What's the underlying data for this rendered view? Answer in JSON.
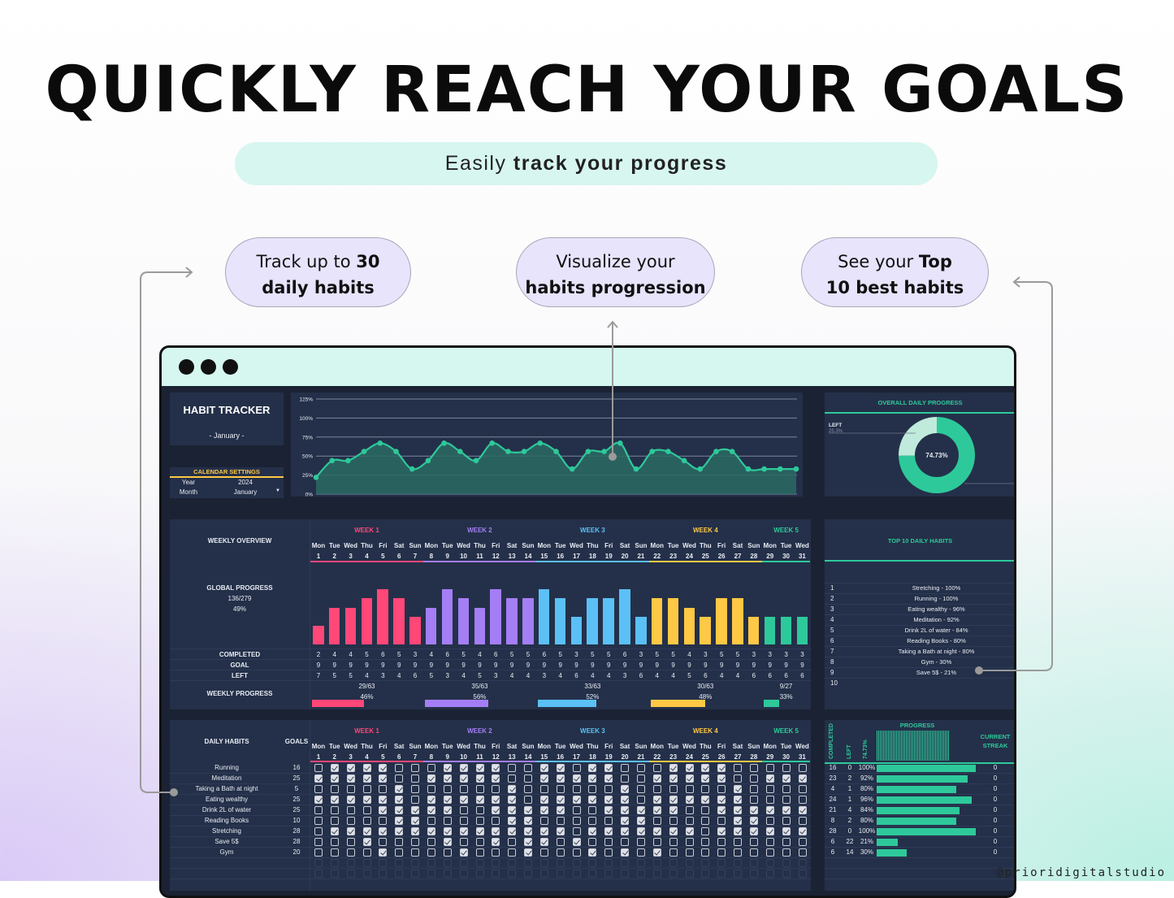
{
  "headline": "QUICKLY REACH YOUR GOALS",
  "subtitle": {
    "pre": "Easily ",
    "bold": "track your progress"
  },
  "callouts": [
    {
      "line1_pre": "Track up to ",
      "line1_bold": "30",
      "line2_bold": "daily habits"
    },
    {
      "line1_pre": "Visualize your",
      "line1_bold": "",
      "line2_bold": "habits progression"
    },
    {
      "line1_pre": "See your ",
      "line1_bold": "Top",
      "line2_bold": "10 best habits"
    }
  ],
  "watermark": "@prioridigitalstudio",
  "colors": {
    "accent": "#2ec99a",
    "panel": "#243049",
    "bg": "#1b2234",
    "weeks": [
      "#ff4778",
      "#a47ef5",
      "#5bc0f5",
      "#ffc845",
      "#2ec99a"
    ]
  },
  "tracker": {
    "title": "HABIT TRACKER",
    "month_label": "- January -",
    "settings": {
      "title": "CALENDAR SETTINGS",
      "year_label": "Year",
      "year": "2024",
      "month_label": "Month",
      "month": "January"
    }
  },
  "weeks": [
    "WEEK 1",
    "WEEK 2",
    "WEEK 3",
    "WEEK 4",
    "WEEK 5"
  ],
  "days": [
    "Mon",
    "Tue",
    "Wed",
    "Thu",
    "Fri",
    "Sat",
    "Sun",
    "Mon",
    "Tue",
    "Wed",
    "Thu",
    "Fri",
    "Sat",
    "Sun",
    "Mon",
    "Tue",
    "Wed",
    "Thu",
    "Fri",
    "Sat",
    "Sun",
    "Mon",
    "Tue",
    "Wed",
    "Thu",
    "Fri",
    "Sat",
    "Sun",
    "Mon",
    "Tue",
    "Wed"
  ],
  "weekly": {
    "title": "WEEKLY OVERVIEW",
    "global_label": "GLOBAL PROGRESS",
    "global_fraction": "136/279",
    "global_pct": "49%",
    "completed_label": "COMPLETED",
    "goal_label": "GOAL",
    "left_label": "LEFT",
    "weekly_label": "WEEKLY PROGRESS",
    "completed": [
      2,
      4,
      4,
      5,
      6,
      5,
      3,
      4,
      6,
      5,
      4,
      6,
      5,
      5,
      6,
      5,
      3,
      5,
      5,
      6,
      3,
      5,
      5,
      4,
      3,
      5,
      5,
      3,
      3,
      3,
      3
    ],
    "goal": [
      9,
      9,
      9,
      9,
      9,
      9,
      9,
      9,
      9,
      9,
      9,
      9,
      9,
      9,
      9,
      9,
      9,
      9,
      9,
      9,
      9,
      9,
      9,
      9,
      9,
      9,
      9,
      9,
      9,
      9,
      9
    ],
    "left": [
      7,
      5,
      5,
      4,
      3,
      4,
      6,
      5,
      3,
      4,
      5,
      3,
      4,
      4,
      3,
      4,
      6,
      4,
      4,
      3,
      6,
      4,
      4,
      5,
      6,
      4,
      4,
      6,
      6,
      6,
      6
    ],
    "week_progress": [
      {
        "fraction": "29/63",
        "pct": 46
      },
      {
        "fraction": "35/63",
        "pct": 56
      },
      {
        "fraction": "33/63",
        "pct": 52
      },
      {
        "fraction": "30/63",
        "pct": 48
      },
      {
        "fraction": "9/27",
        "pct": 33
      }
    ]
  },
  "chart_data": [
    {
      "type": "area",
      "x": [
        1,
        2,
        3,
        4,
        5,
        6,
        7,
        8,
        9,
        10,
        11,
        12,
        13,
        14,
        15,
        16,
        17,
        18,
        19,
        20,
        21,
        22,
        23,
        24,
        25,
        26,
        27,
        28,
        29,
        30,
        31
      ],
      "values": [
        22,
        44,
        44,
        56,
        67,
        56,
        33,
        44,
        67,
        56,
        44,
        67,
        56,
        56,
        67,
        56,
        33,
        56,
        56,
        67,
        33,
        56,
        56,
        44,
        33,
        56,
        56,
        33,
        33,
        33,
        33
      ],
      "yticks": [
        "0%",
        "25%",
        "50%",
        "75%",
        "100%",
        "125%"
      ],
      "ylim": [
        0,
        125
      ],
      "grid": true,
      "color": "#2ec99a"
    },
    {
      "type": "pie",
      "title": "OVERALL DAILY PROGRESS",
      "center_label": "74.73%",
      "slices": [
        {
          "name": "COMPLETED",
          "value": 74.73
        },
        {
          "name": "LEFT",
          "value": 25.3,
          "label": "25.3%"
        }
      ],
      "colors": [
        "#2ec99a",
        "#bfeadc"
      ]
    }
  ],
  "top10": {
    "title": "TOP 10 DAILY HABITS",
    "items": [
      "Stretching - 100%",
      "Running - 100%",
      "Eating wealthy - 96%",
      "Meditation - 92%",
      "Drink 2L of water - 84%",
      "Reading Books - 80%",
      "Taking a Bath at night - 80%",
      "Gym - 30%",
      "Save 5$ - 21%",
      ""
    ]
  },
  "daily": {
    "title": "DAILY HABITS",
    "goals_label": "GOALS",
    "habits": [
      {
        "name": "Running",
        "goal": 16,
        "completed": 16,
        "left": 0,
        "pct": 100,
        "streak": 0,
        "checks": "0111100011110011011000111100000"
      },
      {
        "name": "Meditation",
        "goal": 25,
        "completed": 23,
        "left": 2,
        "pct": 92,
        "streak": 0,
        "checks": "1111100111110011111001111100111"
      },
      {
        "name": "Taking a Bath at night",
        "goal": 5,
        "completed": 4,
        "left": 1,
        "pct": 80,
        "streak": 0,
        "checks": "0000010000001000000100000010000"
      },
      {
        "name": "Eating wealthy",
        "goal": 25,
        "completed": 24,
        "left": 1,
        "pct": 96,
        "streak": 0,
        "checks": "1111110111111011111101111110000"
      },
      {
        "name": "Drink 2L of water",
        "goal": 25,
        "completed": 21,
        "left": 4,
        "pct": 84,
        "streak": 0,
        "checks": "0000111110011111001111100111111"
      },
      {
        "name": "Reading Books",
        "goal": 10,
        "completed": 8,
        "left": 2,
        "pct": 80,
        "streak": 0,
        "checks": "0000011000001100000110000011000"
      },
      {
        "name": "Stretching",
        "goal": 28,
        "completed": 28,
        "left": 0,
        "pct": 100,
        "streak": 0,
        "checks": "0111111111111111011111110111111"
      },
      {
        "name": "Save 5$",
        "goal": 28,
        "completed": 6,
        "left": 22,
        "pct": 21,
        "streak": 0,
        "checks": "0001000010010110100000000000000"
      },
      {
        "name": "Gym",
        "goal": 20,
        "completed": 6,
        "left": 14,
        "pct": 30,
        "streak": 0,
        "checks": "0000100001000100010101000000000"
      }
    ]
  },
  "progress": {
    "completed_label": "COMPLETED",
    "left_label": "LEFT",
    "overall_pct": "74.73%",
    "progress_label": "PROGRESS",
    "streak_label": "CURRENT STREAK"
  }
}
